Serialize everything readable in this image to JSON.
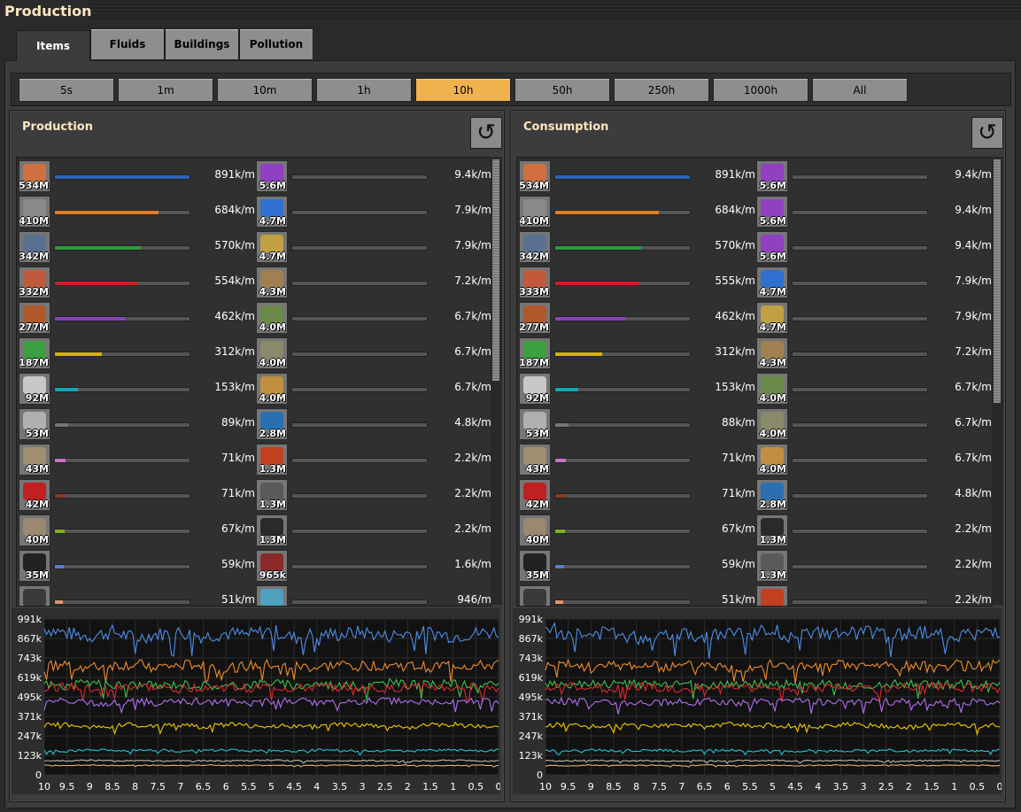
{
  "window": {
    "title": "Production"
  },
  "tabs": [
    {
      "label": "Items",
      "active": true
    },
    {
      "label": "Fluids",
      "active": false
    },
    {
      "label": "Buildings",
      "active": false
    },
    {
      "label": "Pollution",
      "active": false
    }
  ],
  "timeframes": [
    {
      "label": "5s",
      "selected": false
    },
    {
      "label": "1m",
      "selected": false
    },
    {
      "label": "10m",
      "selected": false
    },
    {
      "label": "1h",
      "selected": false
    },
    {
      "label": "10h",
      "selected": true
    },
    {
      "label": "50h",
      "selected": false
    },
    {
      "label": "250h",
      "selected": false
    },
    {
      "label": "1000h",
      "selected": false
    },
    {
      "label": "All",
      "selected": false
    }
  ],
  "production": {
    "title": "Production",
    "reset_icon": "reset-icon",
    "scroll_fraction": 0.5,
    "left": [
      {
        "item": "copper-cable",
        "count": "534M",
        "rate": "891k/m",
        "fraction": 1.0,
        "color": "#2f62b7"
      },
      {
        "item": "stone",
        "count": "410M",
        "rate": "684k/m",
        "fraction": 0.77,
        "color": "#e07d2a"
      },
      {
        "item": "iron-ore",
        "count": "342M",
        "rate": "570k/m",
        "fraction": 0.64,
        "color": "#2e9a3c"
      },
      {
        "item": "copper-plate",
        "count": "332M",
        "rate": "554k/m",
        "fraction": 0.62,
        "color": "#cc1f2a"
      },
      {
        "item": "copper-ore",
        "count": "277M",
        "rate": "462k/m",
        "fraction": 0.52,
        "color": "#8a44c0"
      },
      {
        "item": "electronic-circuit",
        "count": "187M",
        "rate": "312k/m",
        "fraction": 0.35,
        "color": "#d4b400"
      },
      {
        "item": "iron-plate",
        "count": "92M",
        "rate": "153k/m",
        "fraction": 0.17,
        "color": "#12a7b5"
      },
      {
        "item": "iron-stick",
        "count": "53M",
        "rate": "89k/m",
        "fraction": 0.1,
        "color": "#777777"
      },
      {
        "item": "iron-gear-wheel",
        "count": "43M",
        "rate": "71k/m",
        "fraction": 0.08,
        "color": "#c774c7"
      },
      {
        "item": "advanced-circuit",
        "count": "42M",
        "rate": "71k/m",
        "fraction": 0.08,
        "color": "#8a3a1e"
      },
      {
        "item": "rail",
        "count": "40M",
        "rate": "67k/m",
        "fraction": 0.075,
        "color": "#7bb51c"
      },
      {
        "item": "coal",
        "count": "35M",
        "rate": "59k/m",
        "fraction": 0.066,
        "color": "#5a7ed0"
      },
      {
        "item": "stone-brick",
        "count": "",
        "rate": "51k/m",
        "fraction": 0.057,
        "color": "#e0956a"
      }
    ],
    "right": [
      {
        "item": "science-pack",
        "count": "5.6M",
        "rate": "9.4k/m",
        "fraction": 0
      },
      {
        "item": "utility-science-pack",
        "count": "4.7M",
        "rate": "7.9k/m",
        "fraction": 0
      },
      {
        "item": "military-science-pack",
        "count": "4.7M",
        "rate": "7.9k/m",
        "fraction": 0
      },
      {
        "item": "rocket",
        "count": "4.3M",
        "rate": "7.2k/m",
        "fraction": 0
      },
      {
        "item": "low-density-structure",
        "count": "4.0M",
        "rate": "6.7k/m",
        "fraction": 0
      },
      {
        "item": "solar-panel",
        "count": "4.0M",
        "rate": "6.7k/m",
        "fraction": 0
      },
      {
        "item": "inserter",
        "count": "4.0M",
        "rate": "6.7k/m",
        "fraction": 0
      },
      {
        "item": "processing-unit",
        "count": "2.8M",
        "rate": "4.8k/m",
        "fraction": 0
      },
      {
        "item": "rocket-fuel",
        "count": "1.3M",
        "rate": "2.2k/m",
        "fraction": 0
      },
      {
        "item": "engine",
        "count": "1.3M",
        "rate": "2.2k/m",
        "fraction": 0
      },
      {
        "item": "barrel",
        "count": "1.3M",
        "rate": "2.2k/m",
        "fraction": 0
      },
      {
        "item": "grenade",
        "count": "965k",
        "rate": "1.6k/m",
        "fraction": 0
      },
      {
        "item": "speed-module",
        "count": "",
        "rate": "946/m",
        "fraction": 0
      }
    ],
    "chart": {
      "y_ticks": [
        "991k",
        "867k",
        "743k",
        "619k",
        "495k",
        "371k",
        "247k",
        "123k",
        "0"
      ],
      "x_ticks": [
        "10",
        "9.5",
        "9",
        "8.5",
        "8",
        "7.5",
        "7",
        "6.5",
        "6",
        "5.5",
        "5",
        "4.5",
        "4",
        "3.5",
        "3",
        "2.5",
        "2",
        "1.5",
        "1",
        "0.5",
        "0"
      ]
    }
  },
  "consumption": {
    "title": "Consumption",
    "reset_icon": "reset-icon",
    "scroll_fraction": 0.55,
    "left": [
      {
        "item": "copper-cable",
        "count": "534M",
        "rate": "891k/m",
        "fraction": 1.0,
        "color": "#2f62b7"
      },
      {
        "item": "stone",
        "count": "410M",
        "rate": "684k/m",
        "fraction": 0.77,
        "color": "#e07d2a"
      },
      {
        "item": "iron-ore",
        "count": "342M",
        "rate": "570k/m",
        "fraction": 0.64,
        "color": "#2e9a3c"
      },
      {
        "item": "copper-plate",
        "count": "333M",
        "rate": "555k/m",
        "fraction": 0.62,
        "color": "#cc1f2a"
      },
      {
        "item": "copper-ore",
        "count": "277M",
        "rate": "462k/m",
        "fraction": 0.52,
        "color": "#8a44c0"
      },
      {
        "item": "electronic-circuit",
        "count": "187M",
        "rate": "312k/m",
        "fraction": 0.35,
        "color": "#d4b400"
      },
      {
        "item": "iron-plate",
        "count": "92M",
        "rate": "153k/m",
        "fraction": 0.17,
        "color": "#12a7b5"
      },
      {
        "item": "iron-stick",
        "count": "53M",
        "rate": "88k/m",
        "fraction": 0.1,
        "color": "#777777"
      },
      {
        "item": "iron-gear-wheel",
        "count": "43M",
        "rate": "71k/m",
        "fraction": 0.08,
        "color": "#c774c7"
      },
      {
        "item": "advanced-circuit",
        "count": "42M",
        "rate": "71k/m",
        "fraction": 0.08,
        "color": "#8a3a1e"
      },
      {
        "item": "rail",
        "count": "40M",
        "rate": "67k/m",
        "fraction": 0.075,
        "color": "#7bb51c"
      },
      {
        "item": "coal",
        "count": "35M",
        "rate": "59k/m",
        "fraction": 0.066,
        "color": "#5a7ed0"
      },
      {
        "item": "stone-brick",
        "count": "",
        "rate": "51k/m",
        "fraction": 0.057,
        "color": "#e0956a"
      }
    ],
    "right": [
      {
        "item": "science-pack",
        "count": "5.6M",
        "rate": "9.4k/m",
        "fraction": 0
      },
      {
        "item": "science-pack",
        "count": "5.6M",
        "rate": "9.4k/m",
        "fraction": 0
      },
      {
        "item": "science-pack",
        "count": "5.6M",
        "rate": "9.4k/m",
        "fraction": 0
      },
      {
        "item": "utility-science-pack",
        "count": "4.7M",
        "rate": "7.9k/m",
        "fraction": 0
      },
      {
        "item": "military-science-pack",
        "count": "4.7M",
        "rate": "7.9k/m",
        "fraction": 0
      },
      {
        "item": "rocket",
        "count": "4.3M",
        "rate": "7.2k/m",
        "fraction": 0
      },
      {
        "item": "low-density-structure",
        "count": "4.0M",
        "rate": "6.7k/m",
        "fraction": 0
      },
      {
        "item": "solar-panel",
        "count": "4.0M",
        "rate": "6.7k/m",
        "fraction": 0
      },
      {
        "item": "inserter",
        "count": "4.0M",
        "rate": "6.7k/m",
        "fraction": 0
      },
      {
        "item": "processing-unit",
        "count": "2.8M",
        "rate": "4.8k/m",
        "fraction": 0
      },
      {
        "item": "barrel",
        "count": "1.3M",
        "rate": "2.2k/m",
        "fraction": 0
      },
      {
        "item": "engine",
        "count": "1.3M",
        "rate": "2.2k/m",
        "fraction": 0
      },
      {
        "item": "rocket-fuel",
        "count": "",
        "rate": "2.2k/m",
        "fraction": 0
      }
    ],
    "chart": {
      "y_ticks": [
        "991k",
        "867k",
        "743k",
        "619k",
        "495k",
        "371k",
        "247k",
        "123k",
        "0"
      ],
      "x_ticks": [
        "10",
        "9.5",
        "9",
        "8.5",
        "8",
        "7.5",
        "7",
        "6.5",
        "6",
        "5.5",
        "5",
        "4.5",
        "4",
        "3.5",
        "3",
        "2.5",
        "2",
        "1.5",
        "1",
        "0.5",
        "0"
      ]
    }
  },
  "chart_data": [
    {
      "type": "line",
      "title": "",
      "x": [
        10,
        9.5,
        9,
        8.5,
        8,
        7.5,
        7,
        6.5,
        6,
        5.5,
        5,
        4.5,
        4,
        3.5,
        3,
        2.5,
        2,
        1.5,
        1,
        0.5,
        0
      ],
      "ylim": [
        0,
        991000
      ],
      "series": [
        {
          "color": "#4d8ee8",
          "values": [
            930000,
            900000,
            880000,
            910000,
            870000,
            895000,
            905000,
            880000,
            900000,
            890000,
            920000,
            870000,
            900000,
            890000,
            910000,
            880000,
            900000,
            905000,
            880000,
            900000,
            910000
          ]
        },
        {
          "color": "#f08c2e",
          "values": [
            690000,
            700000,
            680000,
            695000,
            700000,
            685000,
            690000,
            710000,
            680000,
            690000,
            700000,
            690000,
            680000,
            700000,
            690000,
            700000,
            690000,
            685000,
            700000,
            690000,
            700000
          ]
        },
        {
          "color": "#3ec24d",
          "values": [
            580000,
            560000,
            590000,
            570000,
            575000,
            565000,
            580000,
            570000,
            560000,
            575000,
            590000,
            565000,
            580000,
            570000,
            560000,
            585000,
            575000,
            570000,
            580000,
            565000,
            570000
          ]
        },
        {
          "color": "#e0252f",
          "values": [
            555000,
            560000,
            545000,
            550000,
            565000,
            550000,
            545000,
            560000,
            555000,
            550000,
            560000,
            545000,
            555000,
            560000,
            550000,
            545000,
            555000,
            560000,
            550000,
            555000,
            550000
          ]
        },
        {
          "color": "#b26ef0",
          "values": [
            465000,
            470000,
            455000,
            460000,
            470000,
            455000,
            465000,
            470000,
            460000,
            455000,
            465000,
            470000,
            460000,
            455000,
            465000,
            470000,
            460000,
            455000,
            465000,
            470000,
            460000
          ]
        },
        {
          "color": "#f0c800",
          "values": [
            315000,
            320000,
            305000,
            310000,
            320000,
            310000,
            315000,
            305000,
            320000,
            310000,
            315000,
            310000,
            305000,
            320000,
            315000,
            310000,
            300000,
            315000,
            320000,
            310000,
            315000
          ]
        },
        {
          "color": "#22c4d2",
          "values": [
            155000,
            150000,
            160000,
            152000,
            155000,
            158000,
            150000,
            154000,
            156000,
            152000,
            155000,
            150000,
            158000,
            154000,
            152000,
            156000,
            150000,
            155000,
            158000,
            152000,
            155000
          ]
        },
        {
          "color": "#bbbbbb",
          "values": [
            90000,
            88000,
            92000,
            89000,
            90000,
            87000,
            91000,
            89000,
            88000,
            90000,
            92000,
            89000,
            88000,
            90000,
            91000,
            89000,
            87000,
            90000,
            92000,
            88000,
            89000
          ]
        },
        {
          "color": "#e0b080",
          "values": [
            60000,
            58000,
            62000,
            59000,
            61000,
            60000,
            58000,
            62000,
            59000,
            60000,
            61000,
            58000,
            60000,
            62000,
            59000,
            60000,
            61000,
            58000,
            60000,
            62000,
            59000
          ]
        }
      ]
    },
    {
      "type": "line",
      "title": "",
      "x": [
        10,
        9.5,
        9,
        8.5,
        8,
        7.5,
        7,
        6.5,
        6,
        5.5,
        5,
        4.5,
        4,
        3.5,
        3,
        2.5,
        2,
        1.5,
        1,
        0.5,
        0
      ],
      "ylim": [
        0,
        991000
      ],
      "series": [
        {
          "color": "#4d8ee8",
          "values": [
            930000,
            900000,
            880000,
            910000,
            870000,
            895000,
            905000,
            880000,
            900000,
            890000,
            920000,
            870000,
            900000,
            890000,
            910000,
            880000,
            900000,
            905000,
            880000,
            900000,
            910000
          ]
        },
        {
          "color": "#f08c2e",
          "values": [
            690000,
            700000,
            680000,
            695000,
            700000,
            685000,
            690000,
            710000,
            680000,
            690000,
            700000,
            690000,
            680000,
            700000,
            690000,
            700000,
            690000,
            685000,
            700000,
            690000,
            700000
          ]
        },
        {
          "color": "#3ec24d",
          "values": [
            575000,
            570000,
            580000,
            572000,
            575000,
            570000,
            578000,
            572000,
            570000,
            575000,
            580000,
            570000,
            575000,
            572000,
            570000,
            578000,
            575000,
            570000,
            576000,
            572000,
            574000
          ]
        },
        {
          "color": "#e0252f",
          "values": [
            555000,
            560000,
            545000,
            550000,
            565000,
            550000,
            545000,
            560000,
            555000,
            550000,
            560000,
            545000,
            555000,
            560000,
            550000,
            545000,
            555000,
            560000,
            550000,
            555000,
            550000
          ]
        },
        {
          "color": "#b26ef0",
          "values": [
            465000,
            468000,
            460000,
            462000,
            466000,
            460000,
            464000,
            466000,
            462000,
            460000,
            464000,
            466000,
            462000,
            460000,
            464000,
            466000,
            462000,
            460000,
            464000,
            466000,
            462000
          ]
        },
        {
          "color": "#f0c800",
          "values": [
            315000,
            320000,
            305000,
            310000,
            320000,
            310000,
            315000,
            305000,
            320000,
            310000,
            315000,
            310000,
            305000,
            320000,
            315000,
            310000,
            300000,
            315000,
            320000,
            310000,
            315000
          ]
        },
        {
          "color": "#22c4d2",
          "values": [
            155000,
            150000,
            160000,
            152000,
            155000,
            158000,
            150000,
            154000,
            156000,
            152000,
            155000,
            150000,
            158000,
            154000,
            152000,
            156000,
            150000,
            155000,
            158000,
            152000,
            155000
          ]
        },
        {
          "color": "#bbbbbb",
          "values": [
            90000,
            88000,
            92000,
            89000,
            90000,
            87000,
            91000,
            89000,
            88000,
            90000,
            92000,
            89000,
            88000,
            90000,
            91000,
            89000,
            87000,
            90000,
            92000,
            88000,
            89000
          ]
        },
        {
          "color": "#e0b080",
          "values": [
            60000,
            58000,
            62000,
            59000,
            61000,
            60000,
            58000,
            62000,
            59000,
            60000,
            61000,
            58000,
            60000,
            62000,
            59000,
            60000,
            61000,
            58000,
            60000,
            62000,
            59000
          ]
        }
      ]
    }
  ]
}
